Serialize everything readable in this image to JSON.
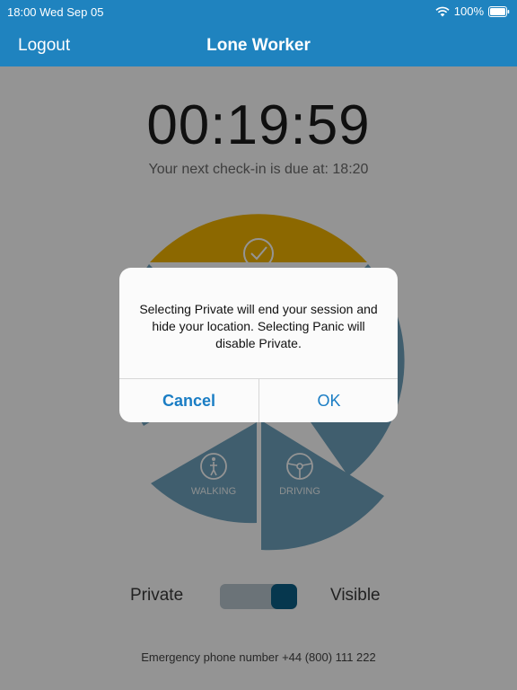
{
  "status_bar": {
    "time": "18:00 Wed Sep 05",
    "battery_percent": "100%",
    "wifi_icon": "wifi-icon",
    "battery_icon": "battery-icon"
  },
  "nav": {
    "logout_label": "Logout",
    "title": "Lone Worker"
  },
  "timer": {
    "value": "00:19:59",
    "checkin_text": "Your next check-in is due at: 18:20"
  },
  "modes": {
    "walking_label": "WALKING",
    "driving_label": "DRIVING",
    "check_icon": "check-circle-icon",
    "walking_icon": "walking-person-icon",
    "driving_icon": "steering-wheel-icon"
  },
  "privacy": {
    "private_label": "Private",
    "visible_label": "Visible",
    "toggle_state": "visible"
  },
  "footer": {
    "emergency_text": "Emergency phone number +44 (800) 111 222"
  },
  "alert": {
    "message": "Selecting Private will end your session and hide your location. Selecting Panic will disable Private.",
    "cancel_label": "Cancel",
    "ok_label": "OK"
  },
  "colors": {
    "brand_blue": "#1f83bf",
    "segment_yellow": "#f1b400",
    "segment_blue": "#6fa3bd",
    "toggle_knob": "#0b5f87"
  }
}
